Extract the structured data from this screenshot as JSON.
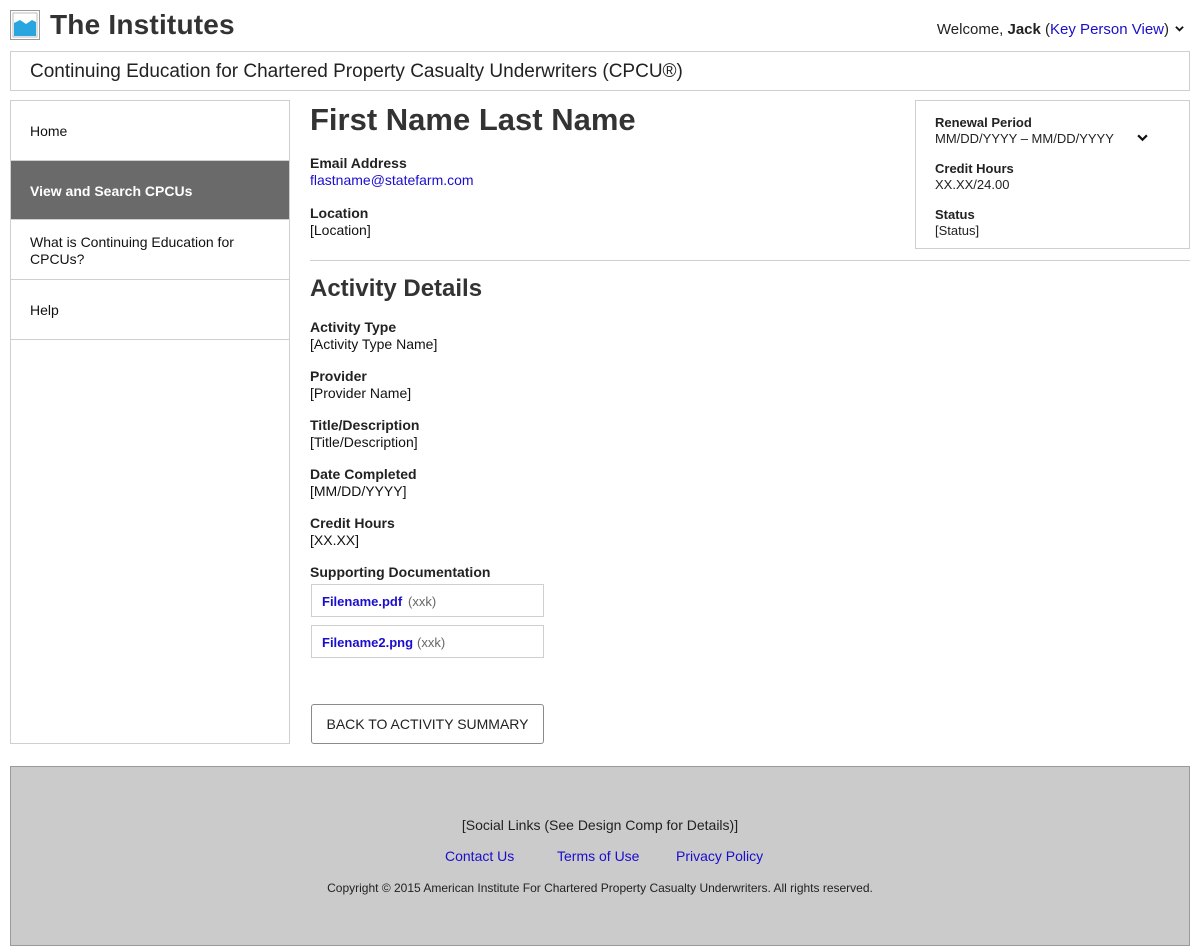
{
  "header": {
    "brand": "The Institutes",
    "welcome_prefix": "Welcome, ",
    "user_name": "Jack",
    "open_paren": " (",
    "role_link": "Key Person View",
    "close_paren": ")"
  },
  "title_bar": {
    "text": "Continuing Education for Chartered Property Casualty Underwriters (CPCU®)"
  },
  "sidebar": {
    "items": [
      {
        "label": "Home"
      },
      {
        "label": "View and Search CPCUs"
      },
      {
        "label_line1": "What is Continuing Education for",
        "label_line2": "CPCUs?"
      },
      {
        "label": "Help"
      }
    ]
  },
  "profile": {
    "name": "First Name Last Name",
    "email_label": "Email Address",
    "email_value": "flastname@statefarm.com",
    "location_label": "Location",
    "location_value": "[Location]"
  },
  "renewal": {
    "period_label": "Renewal Period",
    "period_value": "MM/DD/YYYY – MM/DD/YYYY",
    "credit_label": "Credit Hours",
    "credit_value": "XX.XX/24.00",
    "status_label": "Status",
    "status_value": "[Status]"
  },
  "activity": {
    "title": "Activity Details",
    "fields": [
      {
        "label": "Activity Type",
        "value": "[Activity Type Name]"
      },
      {
        "label": "Provider",
        "value": "[Provider Name]"
      },
      {
        "label": "Title/Description",
        "value": "[Title/Description]"
      },
      {
        "label": "Date Completed",
        "value": "[MM/DD/YYYY]"
      },
      {
        "label": "Credit Hours",
        "value": "[XX.XX]"
      }
    ],
    "docs_label": "Supporting Documentation",
    "files": [
      {
        "name": "Filename.pdf",
        "size": "(xxk)"
      },
      {
        "name": "Filename2.png",
        "size": "(xxk)"
      }
    ],
    "back_button": "BACK TO ACTIVITY SUMMARY"
  },
  "footer": {
    "social": "[Social Links (See Design Comp for Details)]",
    "links": [
      "Contact Us",
      "Terms of Use",
      "Privacy Policy"
    ],
    "copyright": "Copyright © 2015 American Institute For Chartered Property Casualty Underwriters. All rights reserved."
  },
  "colors": {
    "link": "#1a0dcc",
    "nav_active_bg": "#6a6a6a",
    "footer_bg": "#cbcbcb",
    "border": "#cfcfcf",
    "logo_blue": "#29a6e0"
  },
  "icons": {
    "logo": "institutes-logo-icon",
    "user_menu": "chevron-down-icon",
    "renewal_select": "chevron-down-icon"
  }
}
